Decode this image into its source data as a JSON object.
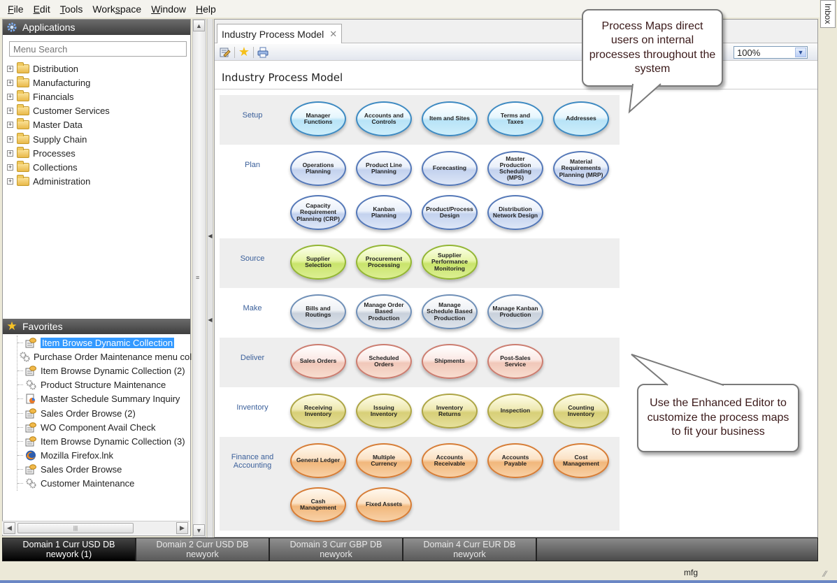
{
  "menubar": {
    "items": [
      {
        "label": "File",
        "u": "F",
        "rest": "ile"
      },
      {
        "label": "Edit",
        "u": "E",
        "rest": "dit"
      },
      {
        "label": "Tools",
        "u": "T",
        "rest": "ools"
      },
      {
        "label": "Workspace",
        "pre": "Work",
        "u": "s",
        "rest": "pace"
      },
      {
        "label": "Window",
        "u": "W",
        "rest": "indow"
      },
      {
        "label": "Help",
        "u": "H",
        "rest": "elp"
      }
    ]
  },
  "applications": {
    "title": "Applications",
    "search_placeholder": "Menu Search",
    "items": [
      "Distribution",
      "Manufacturing",
      "Financials",
      "Customer Services",
      "Master Data",
      "Supply Chain",
      "Processes",
      "Collections",
      "Administration"
    ]
  },
  "favorites": {
    "title": "Favorites",
    "items": [
      {
        "label": "Item Browse Dynamic Collection",
        "icon": "browse-icon",
        "selected": true
      },
      {
        "label": "Purchase Order Maintenance menu coll",
        "icon": "gears-icon"
      },
      {
        "label": "Item Browse Dynamic Collection (2)",
        "icon": "browse-icon"
      },
      {
        "label": "Product Structure Maintenance",
        "icon": "gears-icon"
      },
      {
        "label": "Master Schedule Summary Inquiry",
        "icon": "report-icon"
      },
      {
        "label": "Sales Order Browse (2)",
        "icon": "browse-icon"
      },
      {
        "label": "WO Component Avail Check",
        "icon": "browse-icon"
      },
      {
        "label": "Item Browse Dynamic Collection (3)",
        "icon": "browse-icon"
      },
      {
        "label": "Mozilla Firefox.lnk",
        "icon": "firefox-icon"
      },
      {
        "label": "Sales Order Browse",
        "icon": "browse-icon"
      },
      {
        "label": "Customer Maintenance",
        "icon": "gears-icon"
      }
    ]
  },
  "main": {
    "tab_label": "Industry Process Model",
    "tab_close": "✕",
    "zoom_value": "100%",
    "title": "Industry Process Model"
  },
  "process_map": {
    "rows": [
      {
        "label": "Setup",
        "color": "setup",
        "shaded": true,
        "nodes": [
          "Manager Functions",
          "Accounts and Controls",
          "Item and Sites",
          "Terms and Taxes",
          "Addresses"
        ]
      },
      {
        "label": "Plan",
        "color": "plan",
        "shaded": false,
        "nodes": [
          "Operations Planning",
          "Product Line Planning",
          "Forecasting",
          "Master Production Scheduling (MPS)",
          "Material Requirements Planning (MRP)",
          "Capacity Requirement Planning (CRP)",
          "Kanban Planning",
          "Product/Process Design",
          "Distribution Network Design"
        ]
      },
      {
        "label": "Source",
        "color": "source",
        "shaded": true,
        "nodes": [
          "Supplier Selection",
          "Procurement Processing",
          "Supplier Performance Monitoring"
        ]
      },
      {
        "label": "Make",
        "color": "make",
        "shaded": false,
        "nodes": [
          "Bills and Routings",
          "Manage Order Based Production",
          "Manage Schedule Based Production",
          "Manage Kanban Production"
        ]
      },
      {
        "label": "Deliver",
        "color": "deliver",
        "shaded": true,
        "nodes": [
          "Sales Orders",
          "Scheduled Orders",
          "Shipments",
          "Post-Sales Service"
        ]
      },
      {
        "label": "Inventory",
        "color": "inventory",
        "shaded": false,
        "nodes": [
          "Receiving Inventory",
          "Issuing Inventory",
          "Inventory Returns",
          "Inspection",
          "Counting Inventory"
        ]
      },
      {
        "label": "Finance and Accounting",
        "color": "finance",
        "shaded": true,
        "nodes": [
          "General Ledger",
          "Multiple Currency",
          "Accounts Receivable",
          "Accounts Payable",
          "Cost Management",
          "Cash Management",
          "Fixed Assets"
        ]
      }
    ]
  },
  "callouts": {
    "top": "Process Maps direct users on internal processes throughout the system",
    "bottom": "Use the Enhanced Editor to customize the process maps to fit your business"
  },
  "inbox_label": "Inbox",
  "domains": [
    {
      "line1": "Domain 1 Curr USD DB",
      "line2": "newyork (1)",
      "active": true
    },
    {
      "line1": "Domain 2 Curr USD DB",
      "line2": "newyork"
    },
    {
      "line1": "Domain 3 Curr GBP DB",
      "line2": "newyork"
    },
    {
      "line1": "Domain 4 Curr EUR DB",
      "line2": "newyork"
    }
  ],
  "status": {
    "text": "mfg"
  }
}
